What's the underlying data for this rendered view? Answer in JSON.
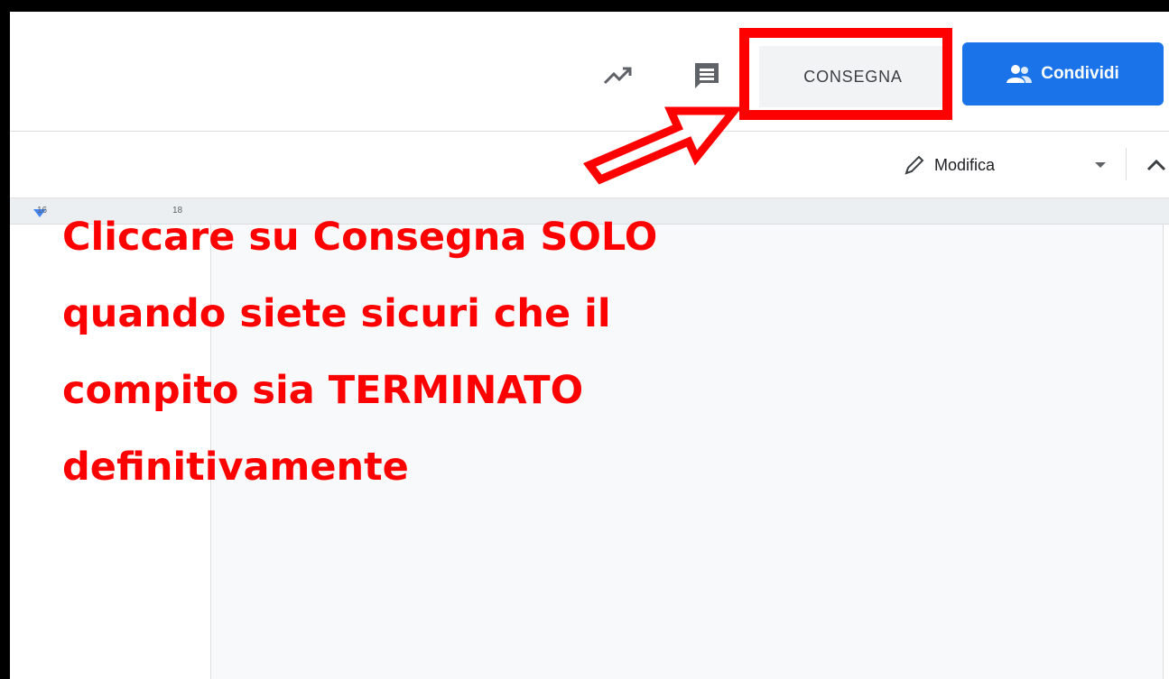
{
  "header": {
    "activity_icon": "trending-up-icon",
    "comments_icon": "comment-icon",
    "submit_label": "CONSEGNA",
    "share_label": "Condividi",
    "share_icon": "people-icon"
  },
  "toolbar": {
    "mode_label": "Modifica",
    "mode_icon": "pencil-icon",
    "dropdown_icon": "caret-down-icon",
    "collapse_icon": "chevron-up-icon"
  },
  "ruler": {
    "marks": [
      "16",
      "18"
    ]
  },
  "annotation": {
    "lines": [
      "Cliccare su Consegna SOLO",
      "quando siete sicuri che il",
      "compito sia TERMINATO",
      "definitivamente"
    ],
    "color": "#ff0000"
  },
  "colors": {
    "share_button": "#1a73e8",
    "highlight": "#ff0000",
    "submit_button_bg": "#f1f3f4"
  }
}
